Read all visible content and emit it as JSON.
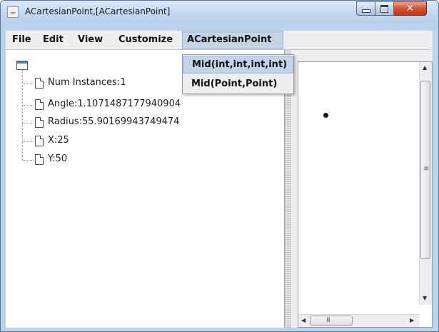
{
  "window": {
    "title": "ACartesianPoint,[ACartesianPoint]",
    "icon": "java-coffee-icon",
    "controls": [
      "minimize-icon",
      "maximize-icon",
      "close-icon"
    ]
  },
  "menubar": {
    "items": [
      "File",
      "Edit",
      "View",
      "Customize",
      "ACartesianPoint"
    ],
    "active": "ACartesianPoint"
  },
  "dropdown": {
    "items": [
      "Mid(int,int,int,int)",
      "Mid(Point,Point)"
    ],
    "highlighted": "Mid(int,int,int,int)"
  },
  "tree": {
    "root_icon": "folder-icon",
    "nodes": [
      "Num Instances:1",
      "Angle:1.1071487177940904",
      "Radius:55.90169943749474",
      "X:25",
      "Y:50"
    ]
  },
  "drawing": {
    "point_label": "",
    "scrollbar_grip": "III"
  },
  "colors": {
    "menu_highlight": "#c4d4e6",
    "titlebar": "#c3d8ef",
    "close_button": "#c23b1c"
  }
}
